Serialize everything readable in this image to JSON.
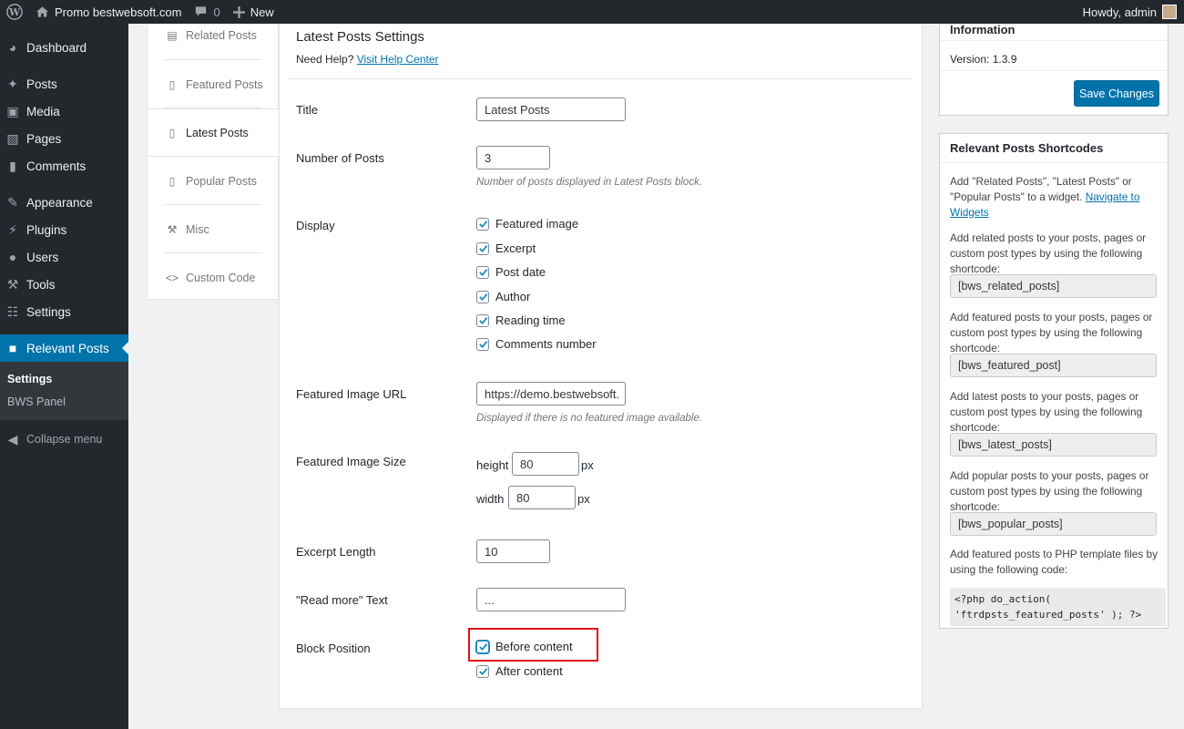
{
  "admin_bar": {
    "site_name": "Promo bestwebsoft.com",
    "comments_count": "0",
    "new_label": "New",
    "howdy": "Howdy, admin"
  },
  "sidebar": {
    "items": [
      {
        "label": "Dashboard",
        "icon": "dashboard-icon"
      },
      {
        "label": "Posts",
        "icon": "pin-icon"
      },
      {
        "label": "Media",
        "icon": "media-icon"
      },
      {
        "label": "Pages",
        "icon": "pages-icon"
      },
      {
        "label": "Comments",
        "icon": "comment-icon"
      },
      {
        "label": "Appearance",
        "icon": "brush-icon"
      },
      {
        "label": "Plugins",
        "icon": "plugin-icon"
      },
      {
        "label": "Users",
        "icon": "user-icon"
      },
      {
        "label": "Tools",
        "icon": "wrench-icon"
      },
      {
        "label": "Settings",
        "icon": "settings-icon"
      },
      {
        "label": "Relevant Posts",
        "icon": "relevant-posts-icon"
      }
    ],
    "submenu": [
      "Settings",
      "BWS Panel"
    ],
    "collapse": "Collapse menu"
  },
  "tabs": [
    "Related Posts",
    "Featured Posts",
    "Latest Posts",
    "Popular Posts",
    "Misc",
    "Custom Code"
  ],
  "main": {
    "title": "Latest Posts Settings",
    "help_prefix": "Need Help?",
    "help_link": "Visit Help Center",
    "fields": {
      "title_label": "Title",
      "title_value": "Latest Posts",
      "num_label": "Number of Posts",
      "num_value": "3",
      "num_desc": "Number of posts displayed in Latest Posts block.",
      "display_label": "Display",
      "display_options": [
        "Featured image",
        "Excerpt",
        "Post date",
        "Author",
        "Reading time",
        "Comments number"
      ],
      "img_url_label": "Featured Image URL",
      "img_url_value": "https://demo.bestwebsoft.",
      "img_url_desc": "Displayed if there is no featured image available.",
      "img_size_label": "Featured Image Size",
      "height_label": "height",
      "height_value": "80",
      "width_label": "width",
      "width_value": "80",
      "px": "px",
      "excerpt_label": "Excerpt Length",
      "excerpt_value": "10",
      "readmore_label": "\"Read more\" Text",
      "readmore_value": "...",
      "block_pos_label": "Block Position",
      "before": "Before content",
      "after": "After content"
    }
  },
  "info_box": {
    "title": "Information",
    "version_label": "Version:",
    "version_value": "1.3.9",
    "save": "Save Changes"
  },
  "shortcodes_box": {
    "title": "Relevant Posts Shortcodes",
    "intro_a": "Add \"Related Posts\", \"Latest Posts\" or",
    "intro_b": "\"Popular Posts\" to a widget.",
    "intro_link_a": "Navigate to",
    "intro_link_b": "Widgets",
    "related_text_1": "Add related posts to your posts, pages or",
    "related_text_2": "custom post types by using the following",
    "related_text_3": "shortcode:",
    "related_code": "[bws_related_posts]",
    "featured_text_1": "Add featured posts to your posts, pages or",
    "featured_text_2": "custom post types by using the following",
    "featured_text_3": "shortcode:",
    "featured_code": "[bws_featured_post]",
    "latest_text_1": "Add latest posts to your posts, pages or",
    "latest_text_2": "custom post types by using the following",
    "latest_text_3": "shortcode:",
    "latest_code": "[bws_latest_posts]",
    "popular_text_1": "Add popular posts to your posts, pages or",
    "popular_text_2": "custom post types by using the following",
    "popular_text_3": "shortcode:",
    "popular_code": "[bws_popular_posts]",
    "php_text_1": "Add featured posts to PHP template files by",
    "php_text_2": "using the following code:",
    "php_code_1": "<?php do_action(",
    "php_code_2": "'ftrdpsts_featured_posts' ); ?>"
  },
  "colors": {
    "accent": "#0073aa",
    "highlight": "#e10e1d",
    "sidebar_bg": "#23282d"
  }
}
